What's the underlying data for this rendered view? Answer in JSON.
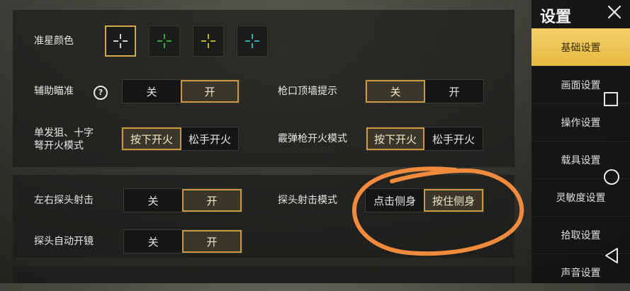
{
  "crosshair": {
    "label": "准星颜色",
    "swatches": [
      {
        "name": "white",
        "color": "#ffffff",
        "selected": true
      },
      {
        "name": "green",
        "color": "#3fcf3a",
        "selected": false
      },
      {
        "name": "yellow",
        "color": "#e5d53a",
        "selected": false
      },
      {
        "name": "cyan",
        "color": "#3ad0dd",
        "selected": false
      }
    ]
  },
  "assist_aim": {
    "label": "辅助瞄准",
    "help_icon": "?",
    "off": "关",
    "on": "开",
    "selected": "开"
  },
  "muzzle_hint": {
    "label": "枪口顶墙提示",
    "off": "关",
    "on": "开",
    "selected": "关"
  },
  "single_fire": {
    "label_line1": "单发狙、十字",
    "label_line2": "弩开火模式",
    "press": "按下开火",
    "release": "松手开火",
    "selected": "按下开火"
  },
  "shotgun_fire": {
    "label": "霰弹枪开火模式",
    "press": "按下开火",
    "release": "松手开火",
    "selected": "按下开火"
  },
  "peek_fire": {
    "label": "左右探头射击",
    "off": "关",
    "on": "开",
    "selected": "开"
  },
  "peek_mode": {
    "label": "探头射击模式",
    "tap": "点击侧身",
    "hold": "按住侧身",
    "selected": "按住侧身"
  },
  "peek_scope": {
    "label": "探头自动开镜",
    "off": "关",
    "on": "开",
    "selected": "开"
  },
  "sidebar": {
    "title": "设置",
    "items": [
      {
        "label": "基础设置",
        "active": true
      },
      {
        "label": "画面设置",
        "active": false
      },
      {
        "label": "操作设置",
        "active": false
      },
      {
        "label": "载具设置",
        "active": false
      },
      {
        "label": "灵敏度设置",
        "active": false
      },
      {
        "label": "拾取设置",
        "active": false
      },
      {
        "label": "声音设置",
        "active": false
      }
    ]
  },
  "colors": {
    "accent": "#c9973e",
    "active_tab": "#f3d06a",
    "annotation": "#f08a3c"
  }
}
